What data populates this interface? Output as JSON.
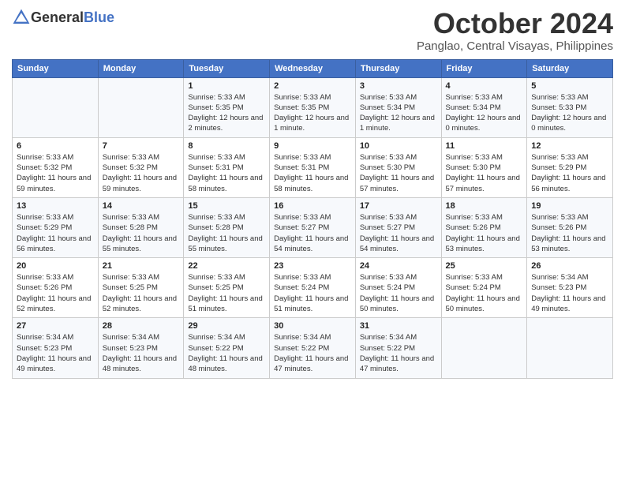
{
  "header": {
    "logo": {
      "text_general": "General",
      "text_blue": "Blue",
      "icon_label": "general-blue-logo"
    },
    "month_title": "October 2024",
    "location": "Panglao, Central Visayas, Philippines"
  },
  "days_of_week": [
    "Sunday",
    "Monday",
    "Tuesday",
    "Wednesday",
    "Thursday",
    "Friday",
    "Saturday"
  ],
  "weeks": [
    [
      {
        "day": "",
        "content": ""
      },
      {
        "day": "",
        "content": ""
      },
      {
        "day": "1",
        "content": "Sunrise: 5:33 AM\nSunset: 5:35 PM\nDaylight: 12 hours\nand 2 minutes."
      },
      {
        "day": "2",
        "content": "Sunrise: 5:33 AM\nSunset: 5:35 PM\nDaylight: 12 hours\nand 1 minute."
      },
      {
        "day": "3",
        "content": "Sunrise: 5:33 AM\nSunset: 5:34 PM\nDaylight: 12 hours\nand 1 minute."
      },
      {
        "day": "4",
        "content": "Sunrise: 5:33 AM\nSunset: 5:34 PM\nDaylight: 12 hours\nand 0 minutes."
      },
      {
        "day": "5",
        "content": "Sunrise: 5:33 AM\nSunset: 5:33 PM\nDaylight: 12 hours\nand 0 minutes."
      }
    ],
    [
      {
        "day": "6",
        "content": "Sunrise: 5:33 AM\nSunset: 5:32 PM\nDaylight: 11 hours\nand 59 minutes."
      },
      {
        "day": "7",
        "content": "Sunrise: 5:33 AM\nSunset: 5:32 PM\nDaylight: 11 hours\nand 59 minutes."
      },
      {
        "day": "8",
        "content": "Sunrise: 5:33 AM\nSunset: 5:31 PM\nDaylight: 11 hours\nand 58 minutes."
      },
      {
        "day": "9",
        "content": "Sunrise: 5:33 AM\nSunset: 5:31 PM\nDaylight: 11 hours\nand 58 minutes."
      },
      {
        "day": "10",
        "content": "Sunrise: 5:33 AM\nSunset: 5:30 PM\nDaylight: 11 hours\nand 57 minutes."
      },
      {
        "day": "11",
        "content": "Sunrise: 5:33 AM\nSunset: 5:30 PM\nDaylight: 11 hours\nand 57 minutes."
      },
      {
        "day": "12",
        "content": "Sunrise: 5:33 AM\nSunset: 5:29 PM\nDaylight: 11 hours\nand 56 minutes."
      }
    ],
    [
      {
        "day": "13",
        "content": "Sunrise: 5:33 AM\nSunset: 5:29 PM\nDaylight: 11 hours\nand 56 minutes."
      },
      {
        "day": "14",
        "content": "Sunrise: 5:33 AM\nSunset: 5:28 PM\nDaylight: 11 hours\nand 55 minutes."
      },
      {
        "day": "15",
        "content": "Sunrise: 5:33 AM\nSunset: 5:28 PM\nDaylight: 11 hours\nand 55 minutes."
      },
      {
        "day": "16",
        "content": "Sunrise: 5:33 AM\nSunset: 5:27 PM\nDaylight: 11 hours\nand 54 minutes."
      },
      {
        "day": "17",
        "content": "Sunrise: 5:33 AM\nSunset: 5:27 PM\nDaylight: 11 hours\nand 54 minutes."
      },
      {
        "day": "18",
        "content": "Sunrise: 5:33 AM\nSunset: 5:26 PM\nDaylight: 11 hours\nand 53 minutes."
      },
      {
        "day": "19",
        "content": "Sunrise: 5:33 AM\nSunset: 5:26 PM\nDaylight: 11 hours\nand 53 minutes."
      }
    ],
    [
      {
        "day": "20",
        "content": "Sunrise: 5:33 AM\nSunset: 5:26 PM\nDaylight: 11 hours\nand 52 minutes."
      },
      {
        "day": "21",
        "content": "Sunrise: 5:33 AM\nSunset: 5:25 PM\nDaylight: 11 hours\nand 52 minutes."
      },
      {
        "day": "22",
        "content": "Sunrise: 5:33 AM\nSunset: 5:25 PM\nDaylight: 11 hours\nand 51 minutes."
      },
      {
        "day": "23",
        "content": "Sunrise: 5:33 AM\nSunset: 5:24 PM\nDaylight: 11 hours\nand 51 minutes."
      },
      {
        "day": "24",
        "content": "Sunrise: 5:33 AM\nSunset: 5:24 PM\nDaylight: 11 hours\nand 50 minutes."
      },
      {
        "day": "25",
        "content": "Sunrise: 5:33 AM\nSunset: 5:24 PM\nDaylight: 11 hours\nand 50 minutes."
      },
      {
        "day": "26",
        "content": "Sunrise: 5:34 AM\nSunset: 5:23 PM\nDaylight: 11 hours\nand 49 minutes."
      }
    ],
    [
      {
        "day": "27",
        "content": "Sunrise: 5:34 AM\nSunset: 5:23 PM\nDaylight: 11 hours\nand 49 minutes."
      },
      {
        "day": "28",
        "content": "Sunrise: 5:34 AM\nSunset: 5:23 PM\nDaylight: 11 hours\nand 48 minutes."
      },
      {
        "day": "29",
        "content": "Sunrise: 5:34 AM\nSunset: 5:22 PM\nDaylight: 11 hours\nand 48 minutes."
      },
      {
        "day": "30",
        "content": "Sunrise: 5:34 AM\nSunset: 5:22 PM\nDaylight: 11 hours\nand 47 minutes."
      },
      {
        "day": "31",
        "content": "Sunrise: 5:34 AM\nSunset: 5:22 PM\nDaylight: 11 hours\nand 47 minutes."
      },
      {
        "day": "",
        "content": ""
      },
      {
        "day": "",
        "content": ""
      }
    ]
  ]
}
